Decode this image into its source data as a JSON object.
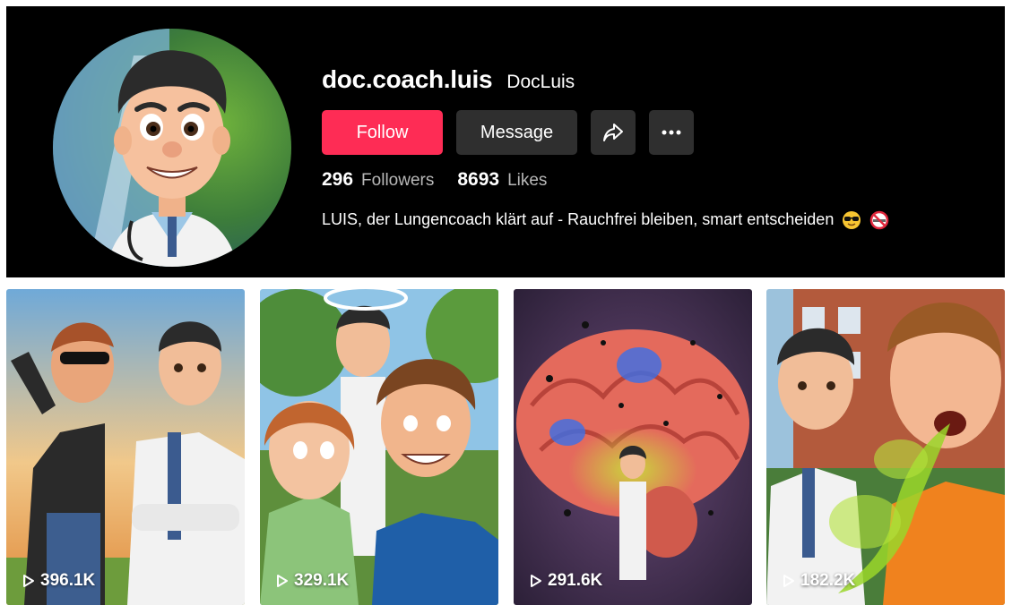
{
  "profile": {
    "username": "doc.coach.luis",
    "nickname": "DocLuis",
    "bio": "LUIS, der Lungencoach klärt auf - Rauchfrei bleiben, smart entscheiden",
    "bio_emojis": [
      "sunglasses-face-emoji",
      "no-smoking-emoji"
    ]
  },
  "buttons": {
    "follow": "Follow",
    "message": "Message",
    "share_icon": "share-arrow-icon",
    "more_icon": "more-dots-icon"
  },
  "stats": {
    "followers_count": "296",
    "followers_label": "Followers",
    "likes_count": "8693",
    "likes_label": "Likes"
  },
  "videos": [
    {
      "views": "396.1K"
    },
    {
      "views": "329.1K"
    },
    {
      "views": "291.6K"
    },
    {
      "views": "182.2K"
    }
  ],
  "colors": {
    "follow_button": "#fe2c55",
    "secondary_button": "#2f2f2f",
    "header_background": "#000000"
  }
}
